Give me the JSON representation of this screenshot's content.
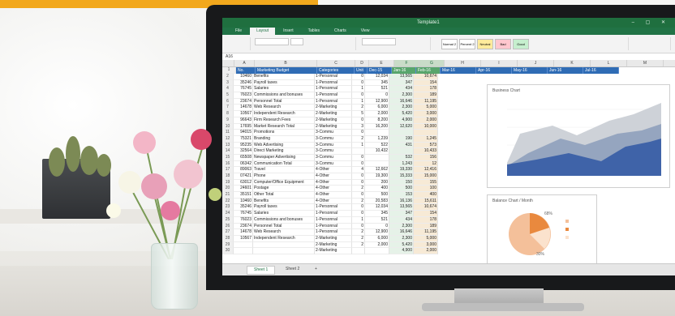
{
  "colors": {
    "accent": "#f2a81d",
    "header_blue": "#2f6cb5",
    "excel_green": "#217346",
    "selected_col_green": "#58a56c"
  },
  "app": {
    "title": "Template1",
    "window_buttons": "– ▢ ✕",
    "tabs": [
      "File",
      "Layout",
      "Insert",
      "Tables",
      "Charts",
      "View"
    ],
    "cell_ref": "A16",
    "styles": [
      "Normal 2",
      "Percent 2",
      "Neutral",
      "Bad",
      "Good"
    ]
  },
  "spreadsheet": {
    "columns": [
      "A",
      "B",
      "C",
      "D",
      "E",
      "F",
      "G",
      "H",
      "I",
      "J",
      "K",
      "L",
      "M"
    ],
    "header": [
      "No.",
      "Marketing Budget",
      "Categories",
      "Unit",
      "Dec-15",
      "Jan-16",
      "Feb-16",
      "Mar-16",
      "Apr-16",
      "May-16",
      "Jun-16",
      "Jul-16"
    ],
    "rows": [
      [
        "2",
        "10460",
        "Benefits",
        "1-Personnal",
        "0",
        "12,034",
        "13,565",
        "10,674"
      ],
      [
        "3",
        "35246",
        "Payroll taxes",
        "1-Personnal",
        "0",
        "345",
        "347",
        "154"
      ],
      [
        "4",
        "76745",
        "Salaries",
        "1-Personnal",
        "1",
        "521",
        "434",
        "178"
      ],
      [
        "5",
        "76023",
        "Commissions and bonuses",
        "1-Personnal",
        "0",
        "0",
        "2,300",
        "189"
      ],
      [
        "6",
        "23674",
        "Personnel Total",
        "1-Personnal",
        "1",
        "12,900",
        "16,646",
        "11,195"
      ],
      [
        "7",
        "14678",
        "Web Research",
        "2-Marketing",
        "2",
        "6,000",
        "2,300",
        "5,000"
      ],
      [
        "8",
        "10567",
        "Independent Research",
        "2-Marketing",
        "5",
        "2,000",
        "5,420",
        "3,000"
      ],
      [
        "9",
        "96643",
        "Firm Research Fees",
        "2-Marketing",
        "0",
        "8,200",
        "4,900",
        "2,000"
      ],
      [
        "10",
        "17695",
        "Market Research Total",
        "2-Marketing",
        "3",
        "16,200",
        "12,620",
        "10,000"
      ],
      [
        "11",
        "94015",
        "Promotions",
        "3-Commu",
        "0",
        "",
        "",
        ""
      ],
      [
        "12",
        "75321",
        "Branding",
        "3-Commu",
        "2",
        "1,239",
        "190",
        "1,245"
      ],
      [
        "13",
        "95235",
        "Web Advertising",
        "3-Commu",
        "1",
        "522",
        "431",
        "573"
      ],
      [
        "14",
        "32564",
        "Direct Marketing",
        "3-Commu",
        "",
        "10,432",
        "",
        "10,433"
      ],
      [
        "15",
        "65508",
        "Newspaper Advertising",
        "3-Commu",
        "0",
        "",
        "532",
        "156"
      ],
      [
        "16",
        "06342",
        "Communication Total",
        "3-Commu",
        "0",
        "",
        "1,243",
        "12"
      ],
      [
        "17",
        "89063",
        "Travel",
        "4-Other",
        "4",
        "12,662",
        "19,330",
        "12,416"
      ],
      [
        "18",
        "07421",
        "Phone",
        "4-Other",
        "0",
        "19,300",
        "15,333",
        "15,000"
      ],
      [
        "19",
        "63012",
        "Computer/Office Equipment",
        "4-Other",
        "0",
        "200",
        "150",
        "155"
      ],
      [
        "20",
        "24601",
        "Postage",
        "4-Other",
        "2",
        "400",
        "500",
        "100"
      ],
      [
        "21",
        "35151",
        "Other Total",
        "4-Other",
        "0",
        "500",
        "153",
        "400"
      ],
      [
        "22",
        "10460",
        "Benefits",
        "4-Other",
        "2",
        "20,583",
        "16,136",
        "15,611"
      ],
      [
        "23",
        "35246",
        "Payroll taxes",
        "1-Personnal",
        "0",
        "12,034",
        "13,565",
        "10,674"
      ],
      [
        "24",
        "76745",
        "Salaries",
        "1-Personnal",
        "0",
        "345",
        "347",
        "154"
      ],
      [
        "25",
        "76023",
        "Commissions and bonuses",
        "1-Personnal",
        "1",
        "521",
        "434",
        "178"
      ],
      [
        "26",
        "23674",
        "Personnel Total",
        "1-Personnal",
        "0",
        "0",
        "2,300",
        "189"
      ],
      [
        "27",
        "14678",
        "Web Research",
        "1-Personnal",
        "2",
        "12,900",
        "16,646",
        "11,195"
      ],
      [
        "28",
        "10567",
        "Independent Research",
        "2-Marketing",
        "2",
        "6,000",
        "2,300",
        "5,000"
      ],
      [
        "29",
        "",
        "",
        "2-Marketing",
        "2",
        "2,000",
        "5,420",
        "3,000"
      ],
      [
        "30",
        "",
        "",
        "2-Marketing",
        "",
        "",
        "4,900",
        "2,000"
      ]
    ],
    "sheet_tabs": [
      "Sheet 1",
      "Sheet 2"
    ]
  },
  "business_chart": {
    "title": "Business Chart"
  },
  "pie_chart": {
    "title": "Balance Chart / Month",
    "labels": [
      "68%",
      "30%"
    ]
  }
}
